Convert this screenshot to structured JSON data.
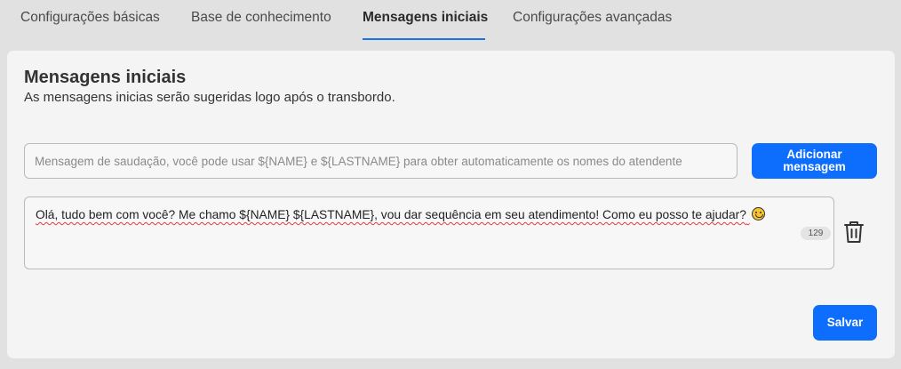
{
  "tabs": [
    {
      "label": "Configurações básicas"
    },
    {
      "label": "Base de conhecimento"
    },
    {
      "label": "Mensagens iniciais",
      "active": true
    },
    {
      "label": "Configurações avançadas"
    }
  ],
  "section": {
    "title": "Mensagens iniciais",
    "subtitle": "As mensagens inicias serão sugeridas logo após o transbordo."
  },
  "greeting_input": {
    "placeholder": "Mensagem de saudação, você pode usar ${NAME} e ${LASTNAME} para obter automaticamente os nomes do atendente",
    "value": ""
  },
  "add_button": {
    "label": "Adicionar mensagem"
  },
  "messages": [
    {
      "text": "Olá, tudo bem com você? Me chamo ${NAME} ${LASTNAME}, vou dar sequência em seu atendimento! Como eu posso te ajudar?",
      "emoji_icon": "smiley-face-icon",
      "char_count": "129"
    }
  ],
  "save_button": {
    "label": "Salvar"
  },
  "colors": {
    "accent": "#0d6efd",
    "tab_underline": "#1a73e8",
    "spellcheck": "#e23b3b"
  }
}
